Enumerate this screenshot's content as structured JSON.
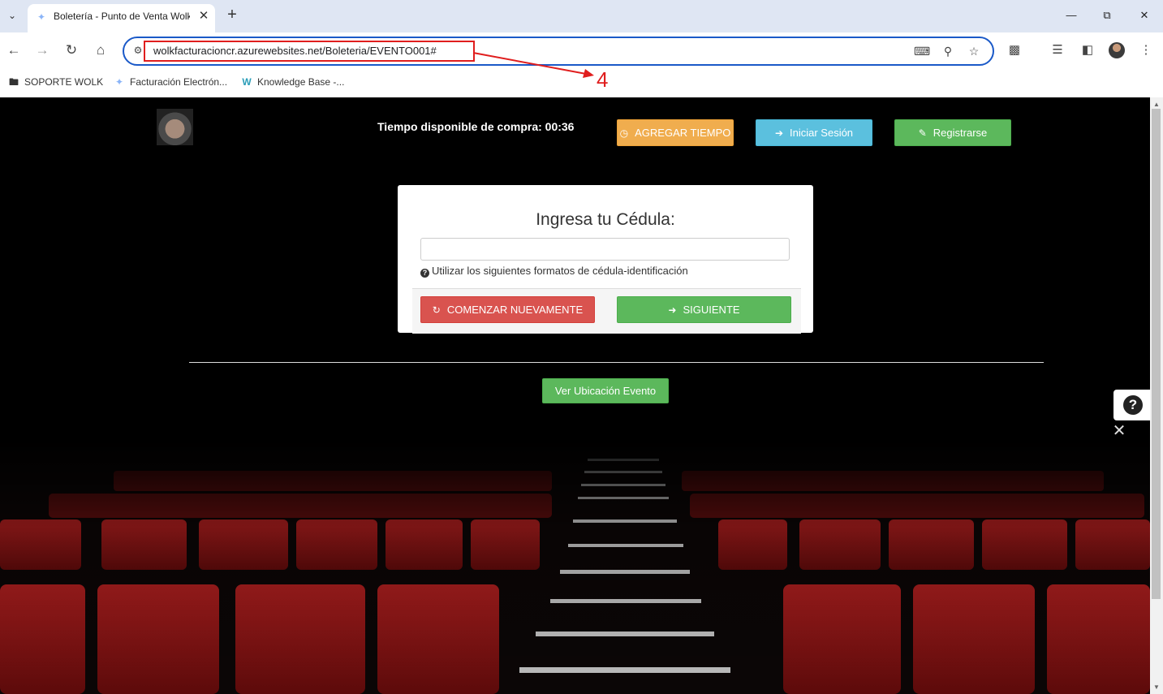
{
  "browser": {
    "tab_title": "Boletería - Punto de Venta Wolk",
    "address": "wolkfacturacioncr.azurewebsites.net/Boleteria/EVENTO001#",
    "bookmarks": [
      {
        "label": "SOPORTE WOLK",
        "icon": "folder-icon"
      },
      {
        "label": "Facturación Electrón...",
        "icon": "wolk-favicon"
      },
      {
        "label": "Knowledge Base -...",
        "icon": "w-logo-icon"
      }
    ],
    "accent": "#1a59c8"
  },
  "annotation": {
    "number": "4",
    "color": "#e01e1e"
  },
  "header": {
    "timer_label": "Tiempo disponible de compra: 00:36",
    "add_time_label": "AGREGAR TIEMPO",
    "login_label": "Iniciar Sesión",
    "register_label": "Registrarse"
  },
  "form": {
    "title": "Ingresa tu Cédula:",
    "cedula_value": "",
    "help_text": "Utilizar los siguientes formatos de cédula-identificación",
    "restart_label": "COMENZAR NUEVAMENTE",
    "next_label": "SIGUIENTE"
  },
  "location_button": "Ver Ubicación Evento",
  "colors": {
    "warning": "#f0ad4e",
    "info": "#5bc0de",
    "success": "#5cb85c",
    "danger": "#d9534f",
    "seat_red": "#8e1515"
  }
}
